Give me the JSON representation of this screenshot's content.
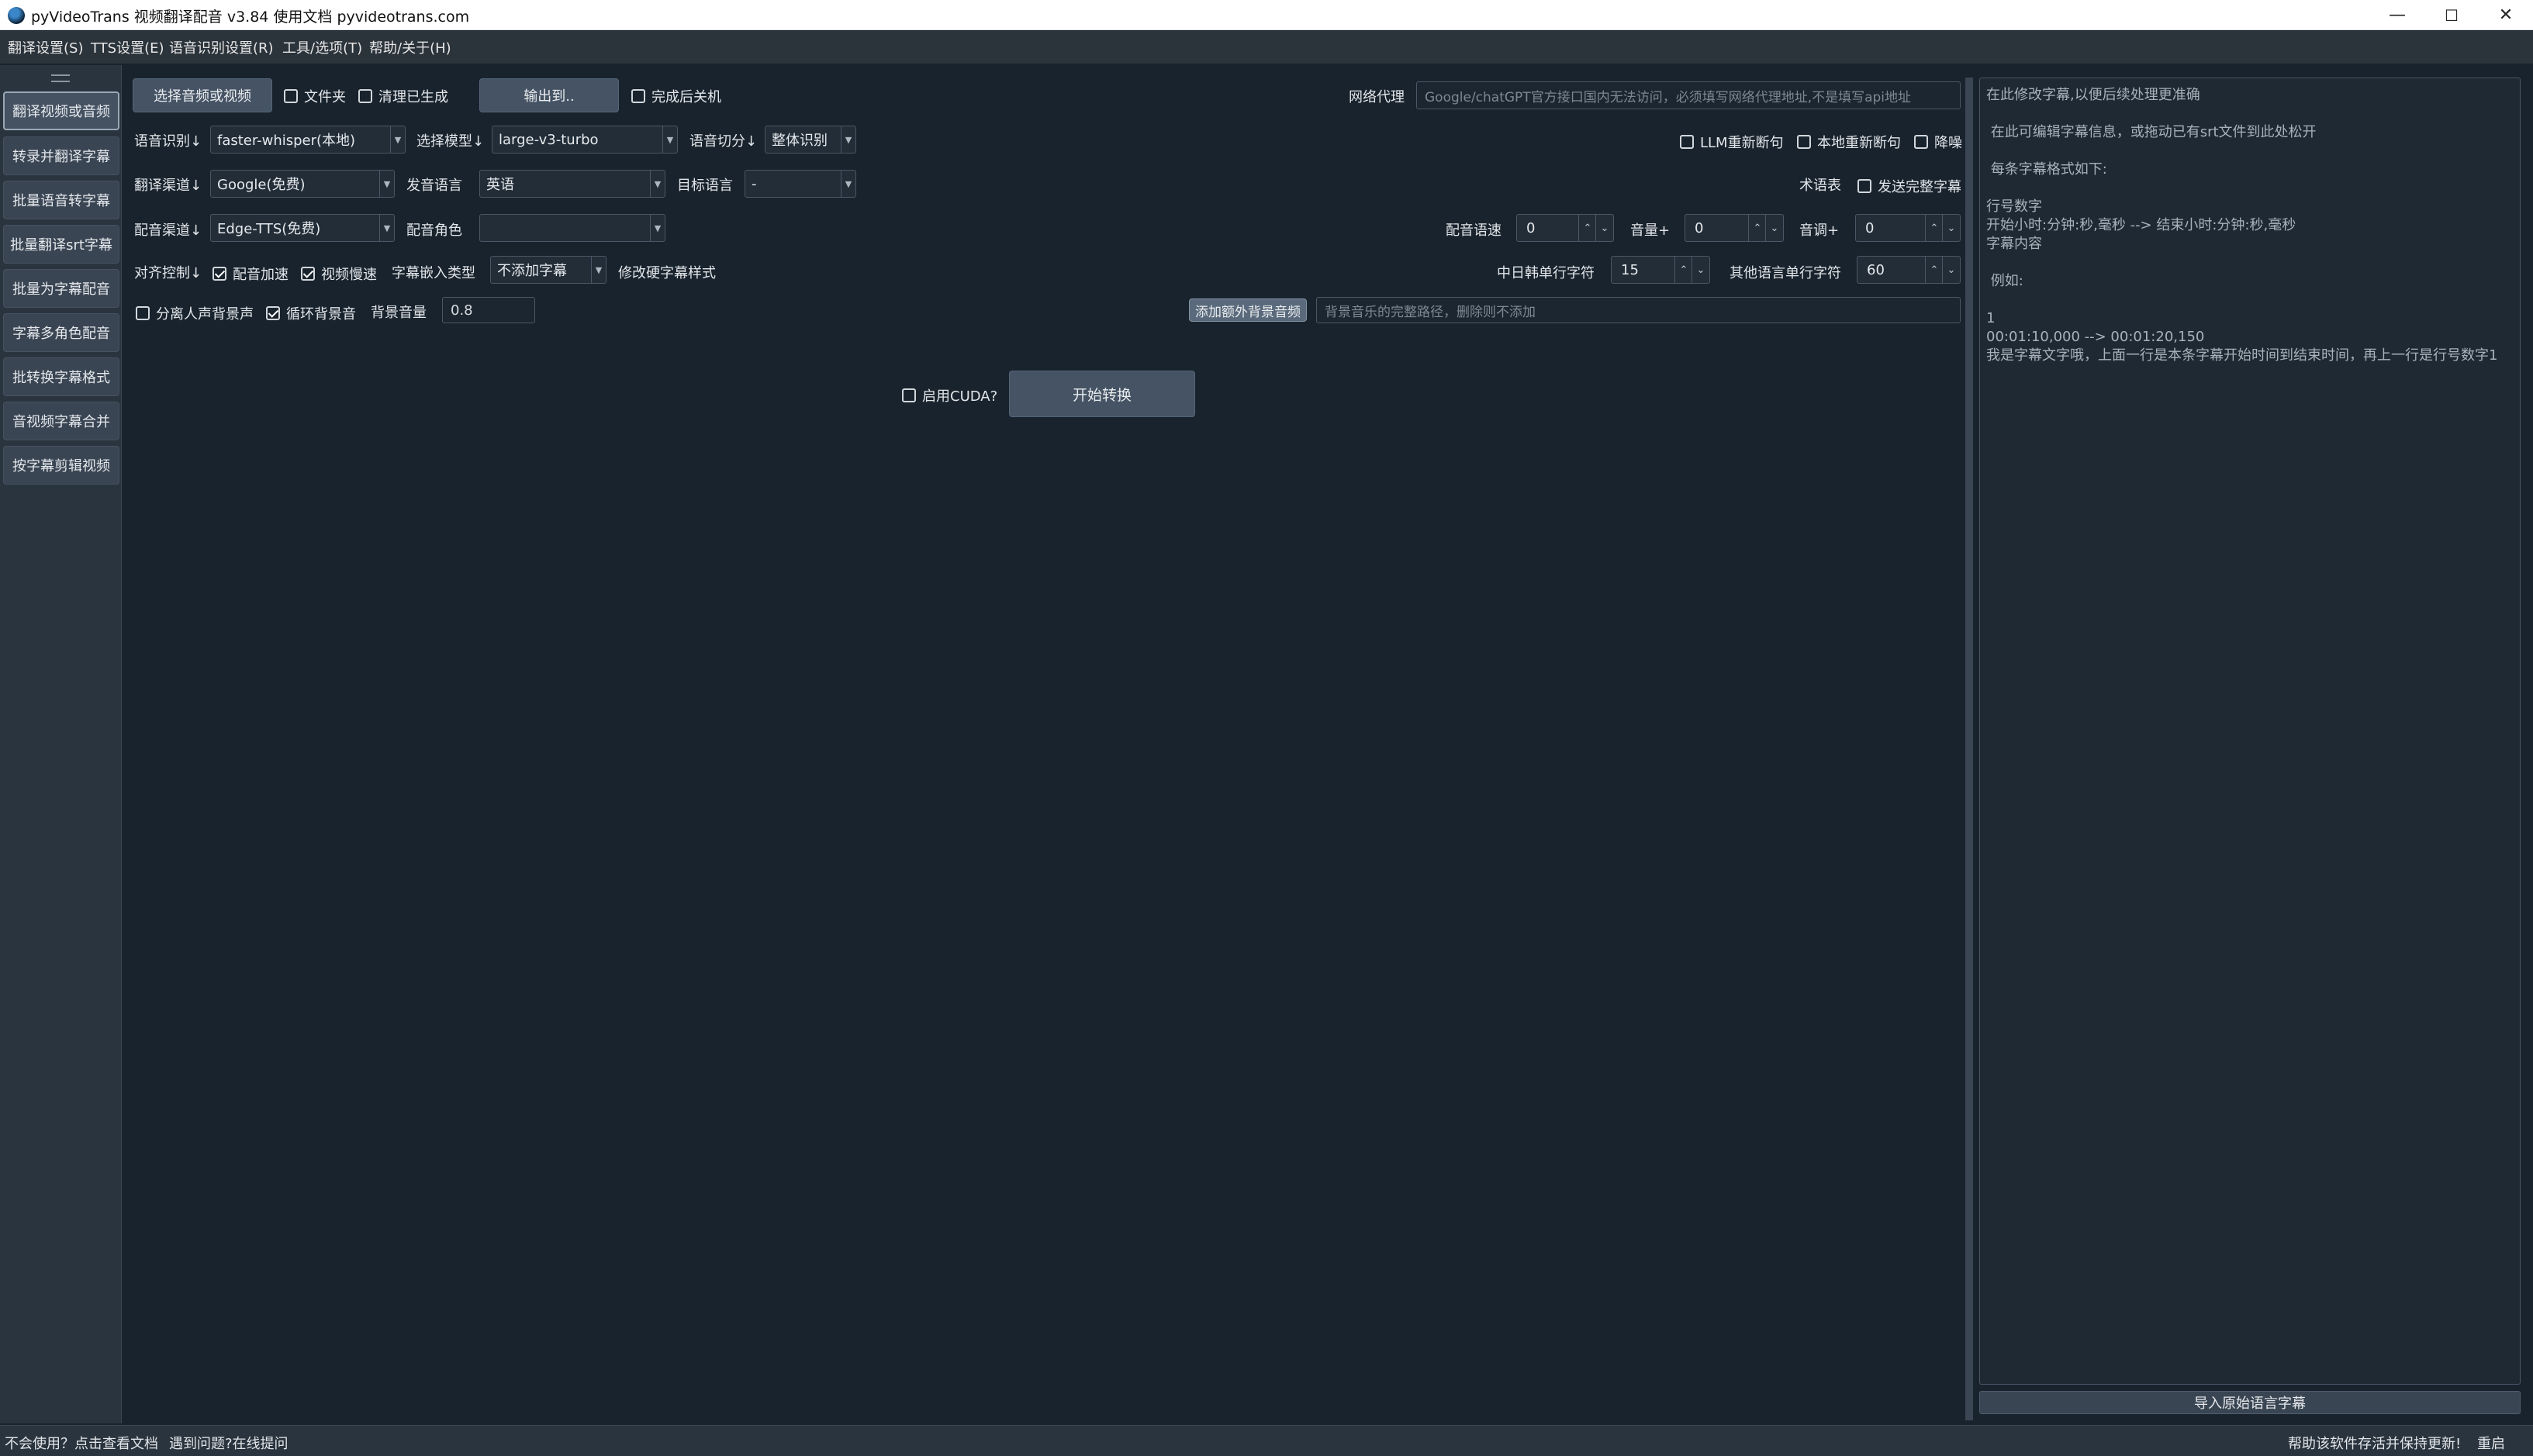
{
  "window": {
    "title": "pyVideoTrans 视频翻译配音 v3.84 使用文档 pyvideotrans.com",
    "minimize": "—",
    "maximize": "☐",
    "close": "✕"
  },
  "menu": [
    "翻译设置(S)",
    "TTS设置(E)",
    "语音识别设置(R)",
    "工具/选项(T)",
    "帮助/关于(H)"
  ],
  "sidebar": {
    "items": [
      "翻译视频或音频",
      "转录并翻译字幕",
      "批量语音转字幕",
      "批量翻译srt字幕",
      "批量为字幕配音",
      "字幕多角色配音",
      "批转换字幕格式",
      "音视频字幕合并",
      "按字幕剪辑视频"
    ]
  },
  "toolbar": {
    "select_media": "选择音频或视频",
    "folder": "文件夹",
    "clear_generated": "清理已生成",
    "output_to": "输出到..",
    "shutdown_after": "完成后关机",
    "proxy_label": "网络代理",
    "proxy_placeholder": "Google/chatGPT官方接口国内无法访问，必须填写网络代理地址,不是填写api地址"
  },
  "row_asr": {
    "asr_label": "语音识别↓",
    "asr_value": "faster-whisper(本地)",
    "model_label": "选择模型↓",
    "model_value": "large-v3-turbo",
    "split_label": "语音切分↓",
    "split_value": "整体识别",
    "llm_resplit": "LLM重新断句",
    "local_resplit": "本地重新断句",
    "denoise": "降噪"
  },
  "row_translate": {
    "channel_label": "翻译渠道↓",
    "channel_value": "Google(免费)",
    "source_label": "发音语言",
    "source_value": "英语",
    "target_label": "目标语言",
    "target_value": "-",
    "glossary": "术语表",
    "send_full": "发送完整字幕"
  },
  "row_tts": {
    "channel_label": "配音渠道↓",
    "channel_value": "Edge-TTS(免费)",
    "role_label": "配音角色",
    "role_value": "",
    "speed_label": "配音语速",
    "speed_value": "0",
    "volume_label": "音量+",
    "volume_value": "0",
    "pitch_label": "音调+",
    "pitch_value": "0"
  },
  "row_align": {
    "align_label": "对齐控制↓",
    "tts_speedup": "配音加速",
    "video_slow": "视频慢速",
    "embed_label": "字幕嵌入类型",
    "embed_value": "不添加字幕",
    "hard_style": "修改硬字幕样式",
    "cjk_label": "中日韩单行字符",
    "cjk_value": "15",
    "other_label": "其他语言单行字符",
    "other_value": "60"
  },
  "row_bg": {
    "separate_vocals": "分离人声背景声",
    "loop_bg": "循环背景音",
    "bg_volume_label": "背景音量",
    "bg_volume_value": "0.8",
    "add_bg_button": "添加额外背景音频",
    "bg_path_placeholder": "背景音乐的完整路径，删除则不添加"
  },
  "action": {
    "cuda": "启用CUDA?",
    "start": "开始转换"
  },
  "editor": {
    "text": "在此修改字幕,以便后续处理更准确\n\n 在此可编辑字幕信息，或拖动已有srt文件到此处松开\n\n 每条字幕格式如下:\n\n行号数字\n开始小时:分钟:秒,毫秒 --> 结束小时:分钟:秒,毫秒\n字幕内容\n\n 例如:\n\n1\n00:01:10,000 --> 00:01:20,150\n我是字幕文字哦，上面一行是本条字幕开始时间到结束时间，再上一行是行号数字1",
    "import_button": "导入原始语言字幕"
  },
  "status": {
    "help_doc": "不会使用？点击查看文档",
    "ask_online": "遇到问题?在线提问",
    "support": "帮助该软件存活并保持更新!",
    "restart": "重启"
  },
  "checkbox_states": {
    "folder": false,
    "clear_generated": false,
    "shutdown_after": false,
    "llm_resplit": false,
    "local_resplit": false,
    "denoise": false,
    "send_full": false,
    "tts_speedup": true,
    "video_slow": true,
    "separate_vocals": false,
    "loop_bg": true,
    "cuda": false
  },
  "colors": {
    "background": "#19232d",
    "panel": "#2a343e",
    "button": "#455364",
    "accent": "#9aa8b6"
  }
}
